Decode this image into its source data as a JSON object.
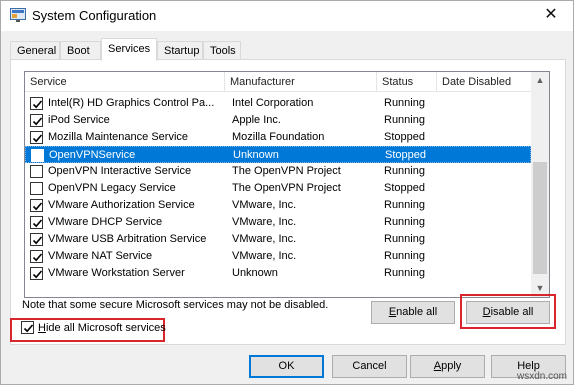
{
  "window": {
    "title": "System Configuration",
    "close_label": "✕"
  },
  "tabs": [
    {
      "label": "General"
    },
    {
      "label": "Boot"
    },
    {
      "label": "Services",
      "active": true
    },
    {
      "label": "Startup"
    },
    {
      "label": "Tools"
    }
  ],
  "table": {
    "columns": [
      "Service",
      "Manufacturer",
      "Status",
      "Date Disabled"
    ],
    "rows": [
      {
        "checked": true,
        "service": "Intel(R) HD Graphics Control Pa...",
        "manufacturer": "Intel Corporation",
        "status": "Running",
        "date_disabled": ""
      },
      {
        "checked": true,
        "service": "iPod Service",
        "manufacturer": "Apple Inc.",
        "status": "Running",
        "date_disabled": ""
      },
      {
        "checked": true,
        "service": "Mozilla Maintenance Service",
        "manufacturer": "Mozilla Foundation",
        "status": "Stopped",
        "date_disabled": ""
      },
      {
        "checked": false,
        "selected": true,
        "service": "OpenVPNService",
        "manufacturer": "Unknown",
        "status": "Stopped",
        "date_disabled": ""
      },
      {
        "checked": false,
        "service": "OpenVPN Interactive Service",
        "manufacturer": "The OpenVPN Project",
        "status": "Running",
        "date_disabled": ""
      },
      {
        "checked": false,
        "service": "OpenVPN Legacy Service",
        "manufacturer": "The OpenVPN Project",
        "status": "Stopped",
        "date_disabled": ""
      },
      {
        "checked": true,
        "service": "VMware Authorization Service",
        "manufacturer": "VMware, Inc.",
        "status": "Running",
        "date_disabled": ""
      },
      {
        "checked": true,
        "service": "VMware DHCP Service",
        "manufacturer": "VMware, Inc.",
        "status": "Running",
        "date_disabled": ""
      },
      {
        "checked": true,
        "service": "VMware USB Arbitration Service",
        "manufacturer": "VMware, Inc.",
        "status": "Running",
        "date_disabled": ""
      },
      {
        "checked": true,
        "service": "VMware NAT Service",
        "manufacturer": "VMware, Inc.",
        "status": "Running",
        "date_disabled": ""
      },
      {
        "checked": true,
        "service": "VMware Workstation Server",
        "manufacturer": "Unknown",
        "status": "Running",
        "date_disabled": ""
      }
    ]
  },
  "note": "Note that some secure Microsoft services may not be disabled.",
  "buttons": {
    "enable_all_key": "E",
    "enable_all_rest": "nable all",
    "disable_all_key": "D",
    "disable_all_rest": "isable all",
    "ok": "OK",
    "cancel": "Cancel",
    "apply_key": "A",
    "apply_rest": "pply",
    "help": "Help"
  },
  "hide_ms": {
    "checked": true,
    "label_key": "H",
    "label_rest": "ide all Microsoft services"
  },
  "colors": {
    "selection": "#0078d7",
    "highlight_box": "#d9262c"
  },
  "watermark": "wsxdn.com"
}
